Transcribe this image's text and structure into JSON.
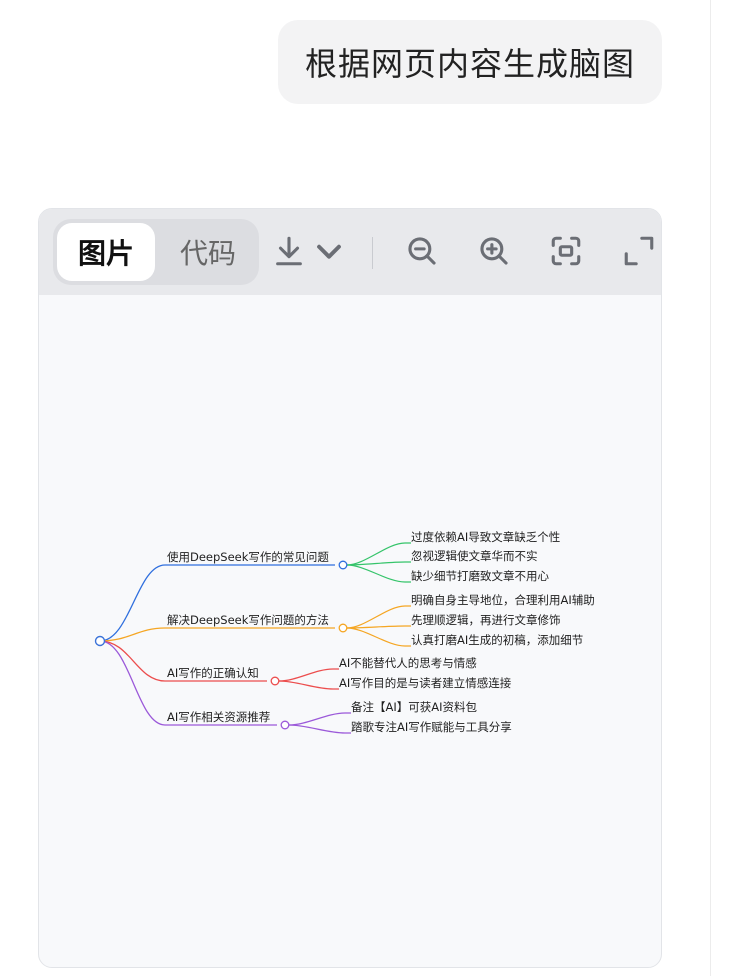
{
  "user_message": "根据网页内容生成脑图",
  "viewer": {
    "tabs": [
      {
        "label": "图片",
        "active": true
      },
      {
        "label": "代码",
        "active": false
      }
    ],
    "toolbar_icons": [
      "download-icon",
      "chevron-down-icon",
      "zoom-out-icon",
      "zoom-in-icon",
      "fit-screen-icon",
      "fullscreen-icon"
    ]
  },
  "mindmap": {
    "root_color": "#3b73d9",
    "branches": [
      {
        "label": "使用DeepSeek写作的常见问题",
        "color": "#2f6fde",
        "children_color": "#35c46a",
        "children": [
          "过度依赖AI导致文章缺乏个性",
          "忽视逻辑使文章华而不实",
          "缺少细节打磨致文章不用心"
        ]
      },
      {
        "label": "解决DeepSeek写作问题的方法",
        "color": "#f5a623",
        "children_color": "#f5a623",
        "children": [
          "明确自身主导地位，合理利用AI辅助",
          "先理顺逻辑，再进行文章修饰",
          "认真打磨AI生成的初稿，添加细节"
        ]
      },
      {
        "label": "AI写作的正确认知",
        "color": "#ec4d4d",
        "children_color": "#ec4d4d",
        "children": [
          "AI不能替代人的思考与情感",
          "AI写作目的是与读者建立情感连接"
        ]
      },
      {
        "label": "AI写作相关资源推荐",
        "color": "#9b59d9",
        "children_color": "#9b59d9",
        "children": [
          "备注【AI】可获AI资料包",
          "踏歌专注AI写作赋能与工具分享"
        ]
      }
    ]
  }
}
